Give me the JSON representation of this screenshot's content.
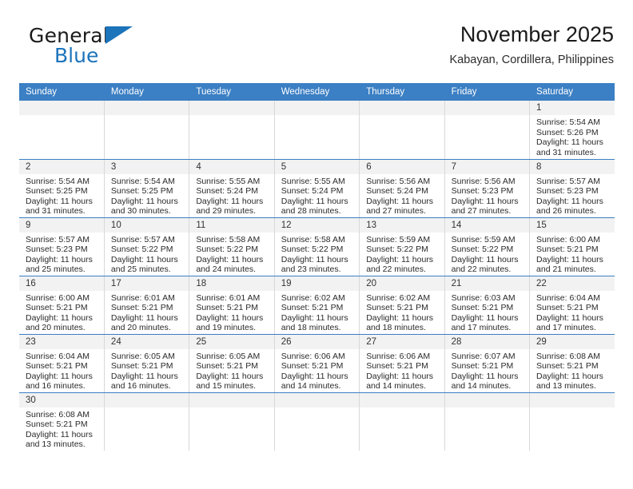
{
  "brand": {
    "name_part1": "General",
    "name_part2": "Blue",
    "triangle_icon": "triangle-icon"
  },
  "header": {
    "title": "November 2025",
    "subtitle": "Kabayan, Cordillera, Philippines"
  },
  "calendar": {
    "weekday_headers": [
      "Sunday",
      "Monday",
      "Tuesday",
      "Wednesday",
      "Thursday",
      "Friday",
      "Saturday"
    ],
    "accent_color": "#3b7fc4",
    "daynum_band_color": "#f2f2f2",
    "weeks": [
      [
        {
          "day": "",
          "sunrise": "",
          "sunset": "",
          "daylight_line1": "",
          "daylight_line2": ""
        },
        {
          "day": "",
          "sunrise": "",
          "sunset": "",
          "daylight_line1": "",
          "daylight_line2": ""
        },
        {
          "day": "",
          "sunrise": "",
          "sunset": "",
          "daylight_line1": "",
          "daylight_line2": ""
        },
        {
          "day": "",
          "sunrise": "",
          "sunset": "",
          "daylight_line1": "",
          "daylight_line2": ""
        },
        {
          "day": "",
          "sunrise": "",
          "sunset": "",
          "daylight_line1": "",
          "daylight_line2": ""
        },
        {
          "day": "",
          "sunrise": "",
          "sunset": "",
          "daylight_line1": "",
          "daylight_line2": ""
        },
        {
          "day": "1",
          "sunrise": "Sunrise: 5:54 AM",
          "sunset": "Sunset: 5:26 PM",
          "daylight_line1": "Daylight: 11 hours",
          "daylight_line2": "and 31 minutes."
        }
      ],
      [
        {
          "day": "2",
          "sunrise": "Sunrise: 5:54 AM",
          "sunset": "Sunset: 5:25 PM",
          "daylight_line1": "Daylight: 11 hours",
          "daylight_line2": "and 31 minutes."
        },
        {
          "day": "3",
          "sunrise": "Sunrise: 5:54 AM",
          "sunset": "Sunset: 5:25 PM",
          "daylight_line1": "Daylight: 11 hours",
          "daylight_line2": "and 30 minutes."
        },
        {
          "day": "4",
          "sunrise": "Sunrise: 5:55 AM",
          "sunset": "Sunset: 5:24 PM",
          "daylight_line1": "Daylight: 11 hours",
          "daylight_line2": "and 29 minutes."
        },
        {
          "day": "5",
          "sunrise": "Sunrise: 5:55 AM",
          "sunset": "Sunset: 5:24 PM",
          "daylight_line1": "Daylight: 11 hours",
          "daylight_line2": "and 28 minutes."
        },
        {
          "day": "6",
          "sunrise": "Sunrise: 5:56 AM",
          "sunset": "Sunset: 5:24 PM",
          "daylight_line1": "Daylight: 11 hours",
          "daylight_line2": "and 27 minutes."
        },
        {
          "day": "7",
          "sunrise": "Sunrise: 5:56 AM",
          "sunset": "Sunset: 5:23 PM",
          "daylight_line1": "Daylight: 11 hours",
          "daylight_line2": "and 27 minutes."
        },
        {
          "day": "8",
          "sunrise": "Sunrise: 5:57 AM",
          "sunset": "Sunset: 5:23 PM",
          "daylight_line1": "Daylight: 11 hours",
          "daylight_line2": "and 26 minutes."
        }
      ],
      [
        {
          "day": "9",
          "sunrise": "Sunrise: 5:57 AM",
          "sunset": "Sunset: 5:23 PM",
          "daylight_line1": "Daylight: 11 hours",
          "daylight_line2": "and 25 minutes."
        },
        {
          "day": "10",
          "sunrise": "Sunrise: 5:57 AM",
          "sunset": "Sunset: 5:22 PM",
          "daylight_line1": "Daylight: 11 hours",
          "daylight_line2": "and 25 minutes."
        },
        {
          "day": "11",
          "sunrise": "Sunrise: 5:58 AM",
          "sunset": "Sunset: 5:22 PM",
          "daylight_line1": "Daylight: 11 hours",
          "daylight_line2": "and 24 minutes."
        },
        {
          "day": "12",
          "sunrise": "Sunrise: 5:58 AM",
          "sunset": "Sunset: 5:22 PM",
          "daylight_line1": "Daylight: 11 hours",
          "daylight_line2": "and 23 minutes."
        },
        {
          "day": "13",
          "sunrise": "Sunrise: 5:59 AM",
          "sunset": "Sunset: 5:22 PM",
          "daylight_line1": "Daylight: 11 hours",
          "daylight_line2": "and 22 minutes."
        },
        {
          "day": "14",
          "sunrise": "Sunrise: 5:59 AM",
          "sunset": "Sunset: 5:22 PM",
          "daylight_line1": "Daylight: 11 hours",
          "daylight_line2": "and 22 minutes."
        },
        {
          "day": "15",
          "sunrise": "Sunrise: 6:00 AM",
          "sunset": "Sunset: 5:21 PM",
          "daylight_line1": "Daylight: 11 hours",
          "daylight_line2": "and 21 minutes."
        }
      ],
      [
        {
          "day": "16",
          "sunrise": "Sunrise: 6:00 AM",
          "sunset": "Sunset: 5:21 PM",
          "daylight_line1": "Daylight: 11 hours",
          "daylight_line2": "and 20 minutes."
        },
        {
          "day": "17",
          "sunrise": "Sunrise: 6:01 AM",
          "sunset": "Sunset: 5:21 PM",
          "daylight_line1": "Daylight: 11 hours",
          "daylight_line2": "and 20 minutes."
        },
        {
          "day": "18",
          "sunrise": "Sunrise: 6:01 AM",
          "sunset": "Sunset: 5:21 PM",
          "daylight_line1": "Daylight: 11 hours",
          "daylight_line2": "and 19 minutes."
        },
        {
          "day": "19",
          "sunrise": "Sunrise: 6:02 AM",
          "sunset": "Sunset: 5:21 PM",
          "daylight_line1": "Daylight: 11 hours",
          "daylight_line2": "and 18 minutes."
        },
        {
          "day": "20",
          "sunrise": "Sunrise: 6:02 AM",
          "sunset": "Sunset: 5:21 PM",
          "daylight_line1": "Daylight: 11 hours",
          "daylight_line2": "and 18 minutes."
        },
        {
          "day": "21",
          "sunrise": "Sunrise: 6:03 AM",
          "sunset": "Sunset: 5:21 PM",
          "daylight_line1": "Daylight: 11 hours",
          "daylight_line2": "and 17 minutes."
        },
        {
          "day": "22",
          "sunrise": "Sunrise: 6:04 AM",
          "sunset": "Sunset: 5:21 PM",
          "daylight_line1": "Daylight: 11 hours",
          "daylight_line2": "and 17 minutes."
        }
      ],
      [
        {
          "day": "23",
          "sunrise": "Sunrise: 6:04 AM",
          "sunset": "Sunset: 5:21 PM",
          "daylight_line1": "Daylight: 11 hours",
          "daylight_line2": "and 16 minutes."
        },
        {
          "day": "24",
          "sunrise": "Sunrise: 6:05 AM",
          "sunset": "Sunset: 5:21 PM",
          "daylight_line1": "Daylight: 11 hours",
          "daylight_line2": "and 16 minutes."
        },
        {
          "day": "25",
          "sunrise": "Sunrise: 6:05 AM",
          "sunset": "Sunset: 5:21 PM",
          "daylight_line1": "Daylight: 11 hours",
          "daylight_line2": "and 15 minutes."
        },
        {
          "day": "26",
          "sunrise": "Sunrise: 6:06 AM",
          "sunset": "Sunset: 5:21 PM",
          "daylight_line1": "Daylight: 11 hours",
          "daylight_line2": "and 14 minutes."
        },
        {
          "day": "27",
          "sunrise": "Sunrise: 6:06 AM",
          "sunset": "Sunset: 5:21 PM",
          "daylight_line1": "Daylight: 11 hours",
          "daylight_line2": "and 14 minutes."
        },
        {
          "day": "28",
          "sunrise": "Sunrise: 6:07 AM",
          "sunset": "Sunset: 5:21 PM",
          "daylight_line1": "Daylight: 11 hours",
          "daylight_line2": "and 14 minutes."
        },
        {
          "day": "29",
          "sunrise": "Sunrise: 6:08 AM",
          "sunset": "Sunset: 5:21 PM",
          "daylight_line1": "Daylight: 11 hours",
          "daylight_line2": "and 13 minutes."
        }
      ],
      [
        {
          "day": "30",
          "sunrise": "Sunrise: 6:08 AM",
          "sunset": "Sunset: 5:21 PM",
          "daylight_line1": "Daylight: 11 hours",
          "daylight_line2": "and 13 minutes."
        },
        {
          "day": "",
          "sunrise": "",
          "sunset": "",
          "daylight_line1": "",
          "daylight_line2": ""
        },
        {
          "day": "",
          "sunrise": "",
          "sunset": "",
          "daylight_line1": "",
          "daylight_line2": ""
        },
        {
          "day": "",
          "sunrise": "",
          "sunset": "",
          "daylight_line1": "",
          "daylight_line2": ""
        },
        {
          "day": "",
          "sunrise": "",
          "sunset": "",
          "daylight_line1": "",
          "daylight_line2": ""
        },
        {
          "day": "",
          "sunrise": "",
          "sunset": "",
          "daylight_line1": "",
          "daylight_line2": ""
        },
        {
          "day": "",
          "sunrise": "",
          "sunset": "",
          "daylight_line1": "",
          "daylight_line2": ""
        }
      ]
    ]
  }
}
